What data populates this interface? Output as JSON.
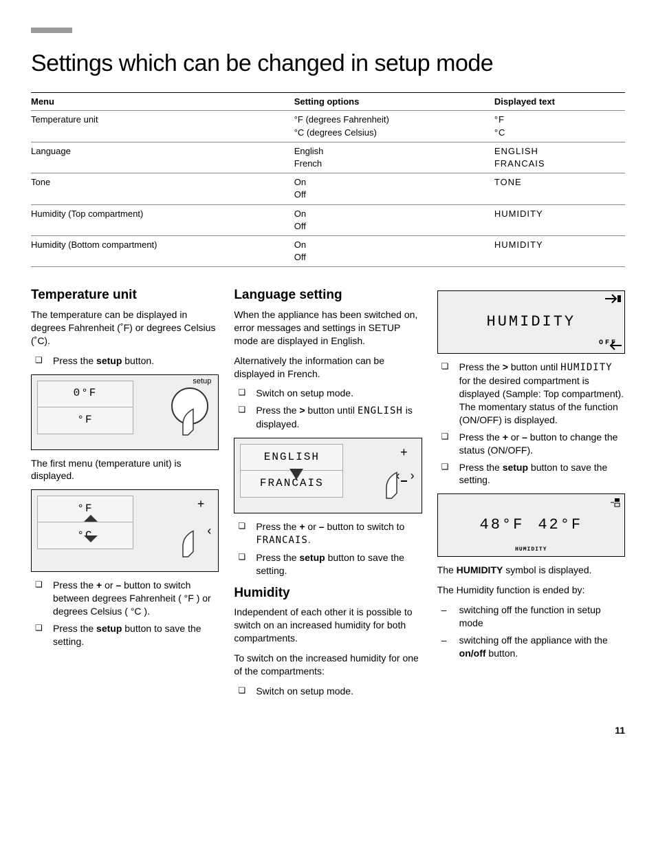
{
  "title": "Settings which can be changed in setup mode",
  "page_number": "11",
  "table": {
    "headers": [
      "Menu",
      "Setting options",
      "Displayed text"
    ],
    "rows": [
      {
        "menu": "Temperature unit",
        "options": "°F (degrees Fahrenheit)\n°C (degrees Celsius)",
        "display": "°F\n°C"
      },
      {
        "menu": "Language",
        "options": "English\nFrench",
        "display": "ENGLISH\nFRANCAIS"
      },
      {
        "menu": "Tone",
        "options": "On\nOff",
        "display": "TONE"
      },
      {
        "menu": "Humidity (Top compartment)",
        "options": "On\nOff",
        "display": "HUMIDITY"
      },
      {
        "menu": "Humidity (Bottom compartment)",
        "options": "On\nOff",
        "display": "HUMIDITY"
      }
    ]
  },
  "col1": {
    "heading": "Temperature unit",
    "intro": "The temperature can be displayed in degrees Fahrenheit (˚F) or degrees Celsius (˚C).",
    "step1_pre": "Press the ",
    "step1_bold": "setup",
    "step1_post": " button.",
    "illus1_top": "0°F",
    "illus1_bottom": "°F",
    "illus1_label": "setup",
    "aftertext": "The first menu (temperature unit) is displayed.",
    "illus2_top": "°F",
    "illus2_bottom": "°C",
    "step2_pre": "Press the ",
    "step2_b1": "+",
    "step2_mid": " or ",
    "step2_b2": "–",
    "step2_post": " button to switch between degrees Fahrenheit ( °F ) or degrees Celsius ( °C ).",
    "step3_pre": "Press the ",
    "step3_bold": "setup",
    "step3_post": " button to save the setting."
  },
  "col2": {
    "heading": "Language setting",
    "p1": "When the appliance has been switched on, error messages and settings in SETUP mode are displayed in English.",
    "p2": "Alternatively the information can be displayed in French.",
    "s1": "Switch on setup mode.",
    "s2_pre": "Press the ",
    "s2_b": ">",
    "s2_mid": " button until ",
    "s2_lcd": "ENGLISH",
    "s2_post": " is displayed.",
    "illus_top": "ENGLISH",
    "illus_bottom": "FRANCAIS",
    "s3_pre": "Press the ",
    "s3_b1": "+",
    "s3_mid": " or ",
    "s3_b2": "–",
    "s3_mid2": " button to switch to ",
    "s3_lcd": "FRANCAIS",
    "s3_post": ".",
    "s4_pre": "Press the ",
    "s4_b": "setup",
    "s4_post": " button to save the setting.",
    "heading2": "Humidity",
    "p3": "Independent of each other it is possible to switch on an increased humidity for both compartments.",
    "p4": "To switch on the increased humidity for one of the compartments:",
    "s5": "Switch on setup mode."
  },
  "col3": {
    "illus1_text": "HUMIDITY",
    "illus1_off": "OFF",
    "s1_pre": "Press the ",
    "s1_b": ">",
    "s1_mid": " button until ",
    "s1_lcd": "HUMIDITY",
    "s1_post": " for the desired compartment is displayed (Sample: Top compartment). The momentary status of the function (ON/OFF) is displayed.",
    "s2_pre": "Press the ",
    "s2_b1": "+",
    "s2_mid": " or ",
    "s2_b2": "–",
    "s2_post": " button to change the status (ON/OFF).",
    "s3_pre": "Press the ",
    "s3_b": "setup",
    "s3_post": " button to save the setting.",
    "illus2_left": "48°F",
    "illus2_right": "42°F",
    "illus2_label": "HUMIDITY",
    "p1_pre": "The ",
    "p1_b": "HUMIDITY",
    "p1_post": " symbol is displayed.",
    "p2": "The Humidity function is ended by:",
    "d1": "switching off the function in setup mode",
    "d2_pre": "switching off the appliance with the ",
    "d2_b": "on/off",
    "d2_post": " button."
  }
}
